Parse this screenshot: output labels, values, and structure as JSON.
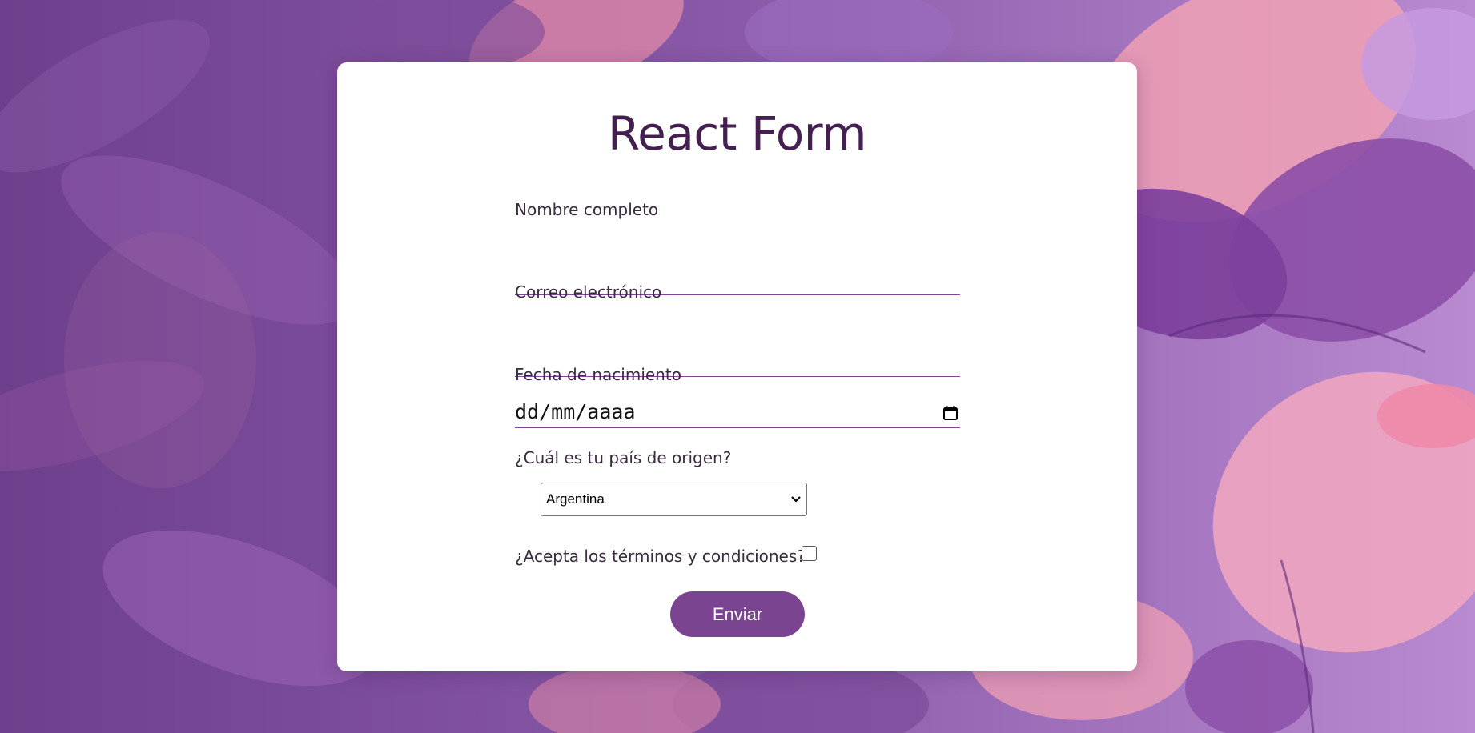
{
  "form": {
    "title": "React Form",
    "fields": {
      "name": {
        "label": "Nombre completo",
        "value": ""
      },
      "email": {
        "label": "Correo electrónico",
        "value": ""
      },
      "birthdate": {
        "label": "Fecha de nacimiento",
        "placeholder": "dd/mm/aaaa",
        "icon": "calendar-icon"
      },
      "country": {
        "label": "¿Cuál es tu país de origen?",
        "selected": "Argentina",
        "icon": "chevron-down-icon"
      },
      "terms": {
        "label": "¿Acepta los términos y condiciones?",
        "checked": false
      }
    },
    "submit_label": "Enviar"
  },
  "colors": {
    "background": "#7a4a98",
    "title": "#43204f",
    "accent": "#7b4490",
    "card": "#ffffff"
  }
}
